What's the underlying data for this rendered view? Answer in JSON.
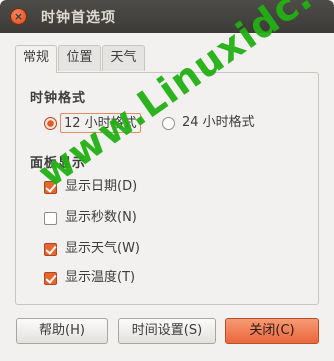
{
  "window": {
    "title": "时钟首选项",
    "close_glyph": "×"
  },
  "tabs": [
    {
      "label": "常规",
      "active": true
    },
    {
      "label": "位置",
      "active": false
    },
    {
      "label": "天气",
      "active": false
    }
  ],
  "clock_format": {
    "title": "时钟格式",
    "options": [
      {
        "label": "12 小时格式",
        "selected": true
      },
      {
        "label": "24 小时格式",
        "selected": false
      }
    ]
  },
  "panel_display": {
    "title": "面板显示",
    "options": [
      {
        "label": "显示日期(D)",
        "checked": true
      },
      {
        "label": "显示秒数(N)",
        "checked": false
      },
      {
        "label": "显示天气(W)",
        "checked": true
      },
      {
        "label": "显示温度(T)",
        "checked": true
      }
    ]
  },
  "buttons": {
    "help": "帮助(H)",
    "time_settings": "时间设置(S)",
    "close": "关闭(C)"
  },
  "watermark": "www.Linuxidc.com",
  "colors": {
    "accent": "#e5672e",
    "titlebar": "#3c3b37",
    "watermark": "#22b014"
  }
}
